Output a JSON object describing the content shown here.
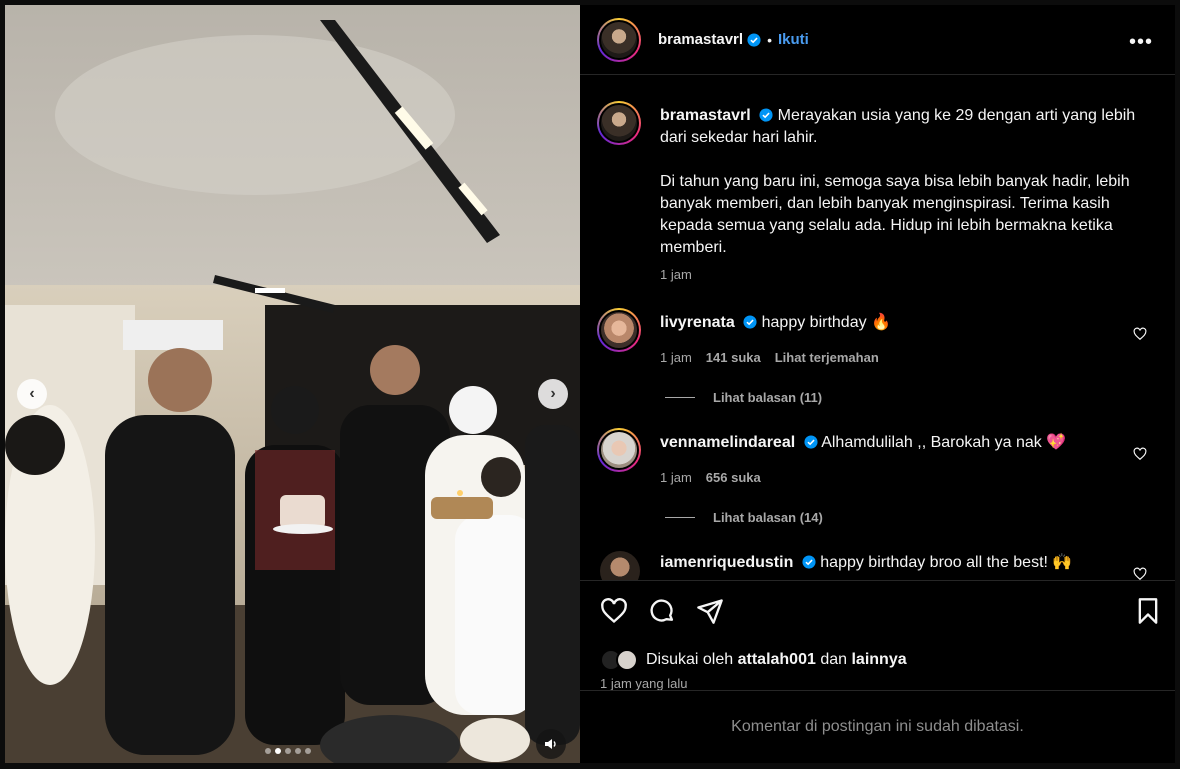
{
  "post": {
    "username": "bramastavrl",
    "follow_label": "Ikuti",
    "separator": "•",
    "more_label": "•••"
  },
  "caption": {
    "username": "bramastavrl",
    "text_line1": "Merayakan usia yang ke 29 dengan arti yang lebih dari sekedar hari lahir.",
    "text_para2": "Di tahun yang baru ini, semoga saya bisa lebih banyak hadir, lebih banyak memberi, dan lebih banyak menginspirasi. Terima kasih kepada semua yang selalu ada. Hidup ini lebih bermakna ketika memberi.",
    "time": "1 jam"
  },
  "comments": [
    {
      "username": "livyrenata",
      "text": "happy birthday 🔥",
      "time": "1 jam",
      "likes": "141 suka",
      "translate": "Lihat terjemahan",
      "replies": "Lihat balasan (11)"
    },
    {
      "username": "vennamelindareal",
      "text": "Alhamdulilah ,, Barokah ya nak 💖",
      "time": "1 jam",
      "likes": "656 suka",
      "replies": "Lihat balasan (14)"
    },
    {
      "username": "iamenriquedustin",
      "text": "happy birthday broo all the best! 🙌"
    }
  ],
  "likes": {
    "prefix": "Disukai oleh",
    "user": "attalah001",
    "joiner": "dan",
    "others": "lainnya"
  },
  "time_ago": "1 jam yang lalu",
  "comments_limited": "Komentar di postingan ini sudah dibatasi.",
  "carousel": {
    "prev": "‹",
    "next": "›",
    "slide_count": 5,
    "active_slide": 2
  },
  "colors": {
    "accent": "#4a9cf0",
    "background": "#000000",
    "muted_text": "#a8a8a8"
  }
}
